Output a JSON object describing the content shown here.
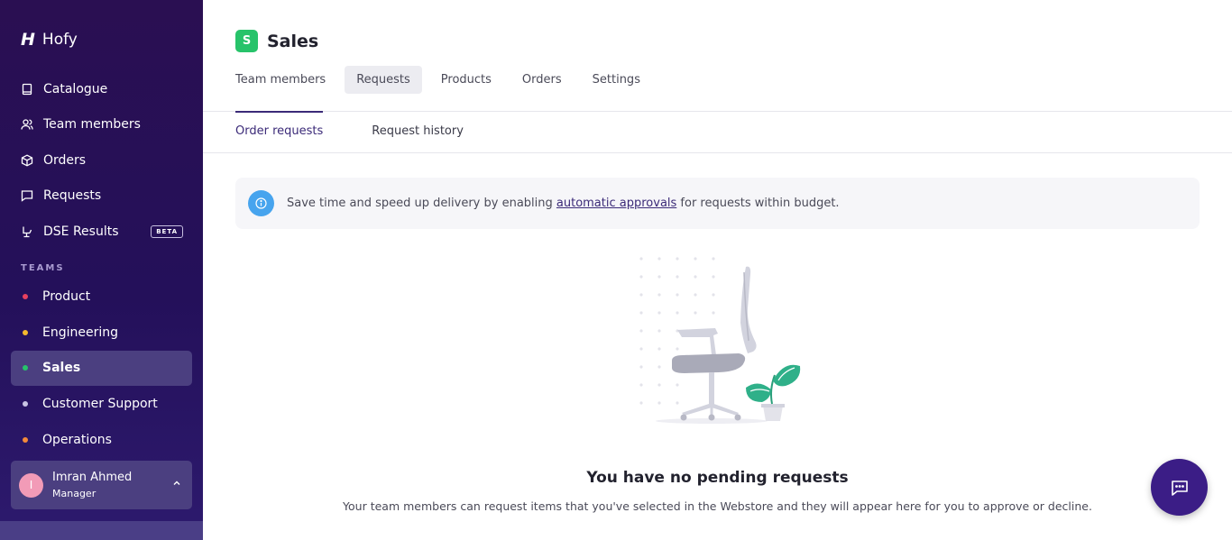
{
  "app": {
    "brand_mark": "H",
    "brand_name": "Hofy"
  },
  "sidebar": {
    "nav": [
      {
        "label": "Catalogue",
        "icon": "book-icon"
      },
      {
        "label": "Team members",
        "icon": "users-icon"
      },
      {
        "label": "Orders",
        "icon": "box-icon"
      },
      {
        "label": "Requests",
        "icon": "message-icon"
      },
      {
        "label": "DSE Results",
        "icon": "chair-icon",
        "badge": "BETA"
      }
    ],
    "teams_title": "TEAMS",
    "teams": [
      {
        "label": "Product",
        "color": "#e8415f"
      },
      {
        "label": "Engineering",
        "color": "#f5b92d"
      },
      {
        "label": "Sales",
        "color": "#27c36a",
        "active": true
      },
      {
        "label": "Customer Support",
        "color": "#c9c4e4"
      },
      {
        "label": "Operations",
        "color": "#f48a3a"
      }
    ],
    "user": {
      "initial": "I",
      "name": "Imran Ahmed",
      "role": "Manager"
    }
  },
  "main": {
    "team_badge": "S",
    "team_badge_color": "#27c36a",
    "title": "Sales",
    "tabs": [
      "Team members",
      "Requests",
      "Products",
      "Orders",
      "Settings"
    ],
    "active_tab": "Requests",
    "subtabs": [
      "Order requests",
      "Request history"
    ],
    "active_subtab": "Order requests",
    "banner": {
      "before": "Save time and speed up delivery by enabling ",
      "link": "automatic approvals",
      "after": " for requests within budget."
    },
    "empty": {
      "title": "You have no pending requests",
      "description": "Your team members can request items that you've selected in the Webstore and they will appear here for you to approve or decline."
    }
  },
  "colors": {
    "sidebar_bg": "#24105a",
    "accent": "#3b2a78",
    "chat_button": "#3b1d86",
    "info": "#47a4ee"
  }
}
